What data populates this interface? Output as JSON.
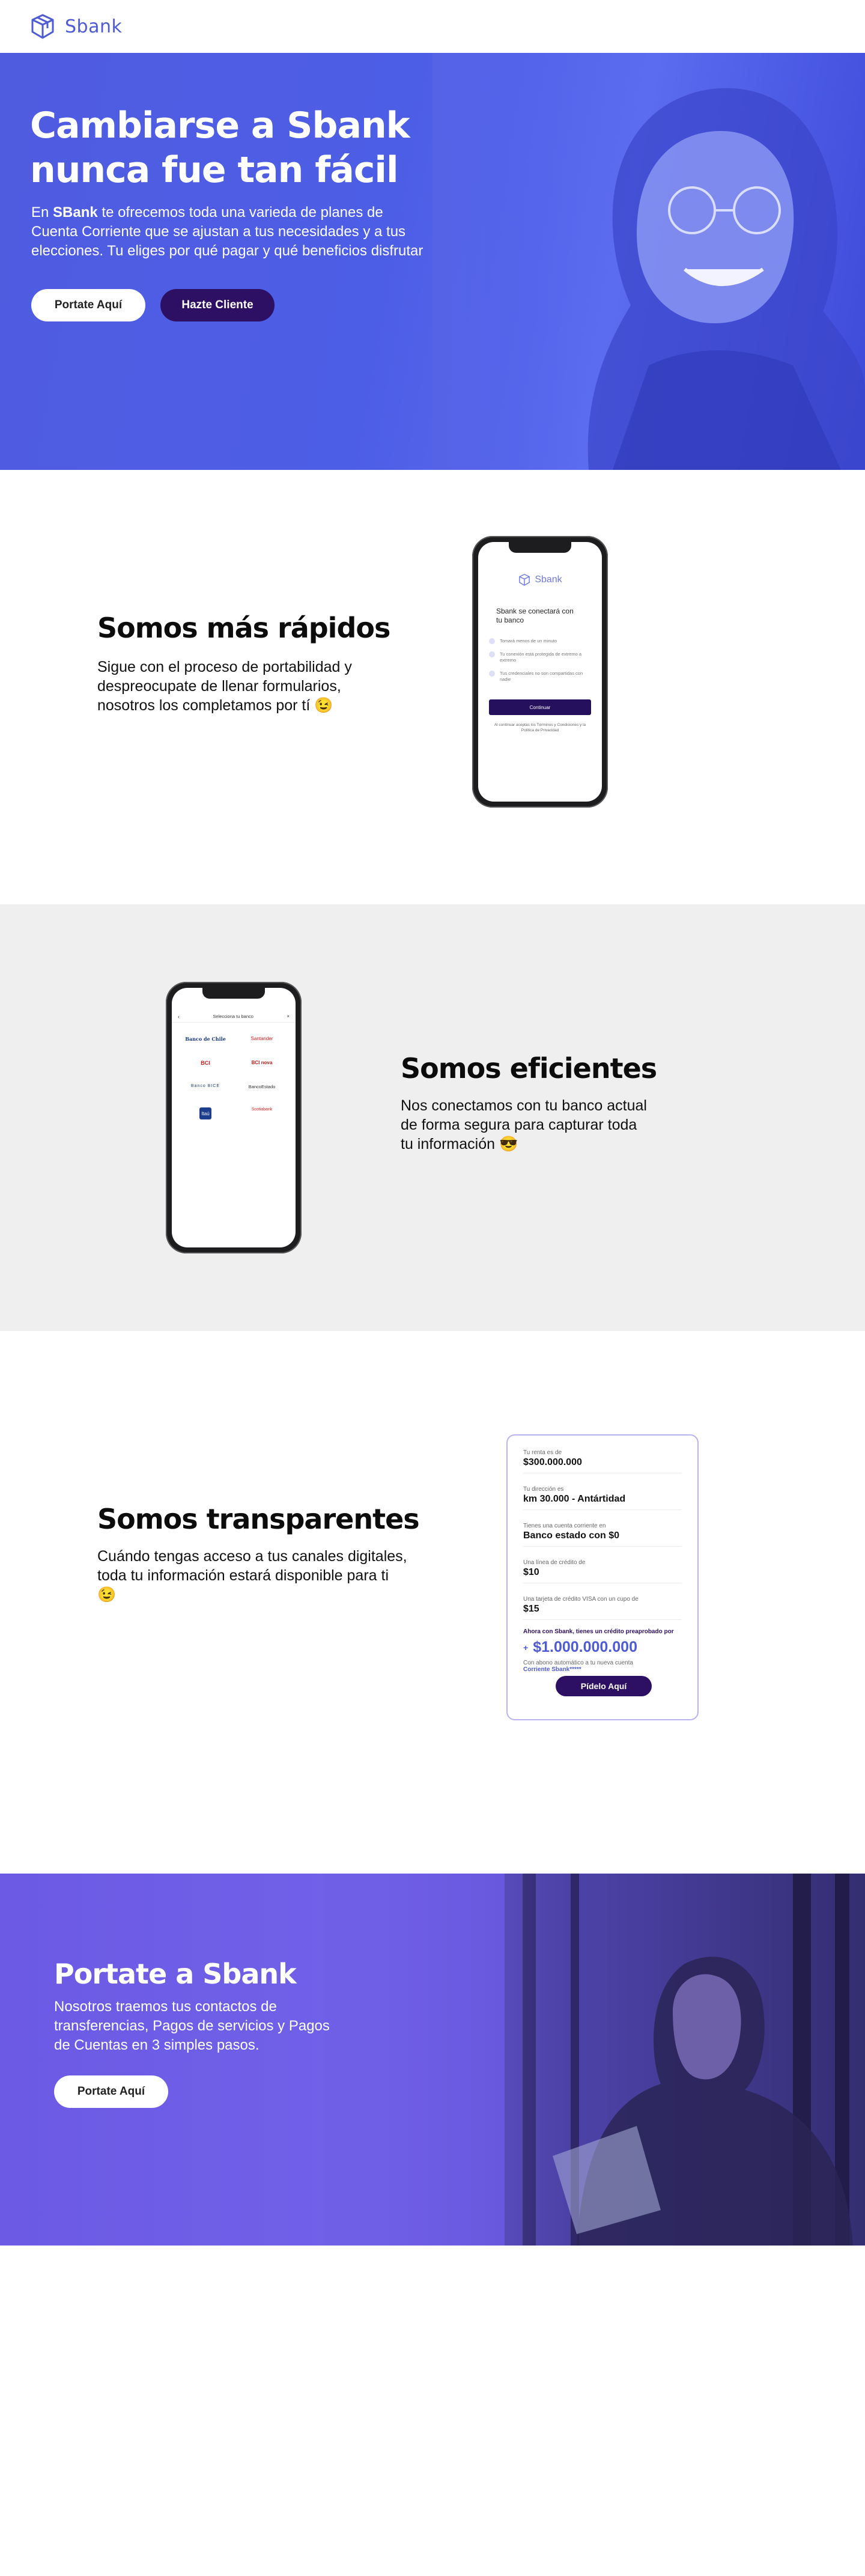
{
  "header": {
    "logo_text": "Sbank",
    "logo_icon": "cube-logo-icon"
  },
  "hero": {
    "title_line1": "Cambiarse a Sbank",
    "title_line2": "nunca fue tan fácil",
    "desc_prefix": "En ",
    "desc_brand": "SBank",
    "desc_rest": " te ofrecemos toda una varieda de planes de Cuenta Corriente que se ajustan a tus necesidades y a tus elecciones. Tu eliges por qué pagar y qué beneficios disfrutar",
    "btn_portate": "Portate Aquí",
    "btn_cliente": "Hazte Cliente"
  },
  "rapidos": {
    "title": "Somos más rápidos",
    "text": "Sigue con el proceso de portabilidad y despreocupate de llenar formularios, nosotros los completamos por tí 😉",
    "phone": {
      "logo_text": "Sbank",
      "heading": "Sbank se conectará con tu banco",
      "items": [
        "Tomará menos de un minuto",
        "Tu conexión está protegida de extremo a extremo",
        "Tus credenciales no son compartidas con nadie"
      ],
      "button": "Continuar",
      "footer": "Al continuar aceptas los Términos y Condiciones y la Política de Privacidad"
    }
  },
  "eficientes": {
    "title": "Somos eficientes",
    "text": "Nos conectamos con tu banco actual de forma segura para capturar toda tu información 😎",
    "phone": {
      "header": "Selecciona tu banco",
      "banks": [
        "Banco de Chile",
        "Santander",
        "BCI",
        "BCI nova",
        "Banco BICE",
        "BancoEstado",
        "Itaú",
        "Scotiabank"
      ]
    }
  },
  "transparentes": {
    "title": "Somos transparentes",
    "text": "Cuándo tengas acceso a tus canales digitales, toda tu información estará disponible para ti 😉",
    "card": {
      "rows": [
        {
          "label": "Tu renta es de",
          "value": "$300.000.000"
        },
        {
          "label": "Tu dirección es",
          "value": "km 30.000 - Antártidad"
        },
        {
          "label": "Tienes una cuenta corriente en",
          "value": "Banco estado con $0"
        },
        {
          "label": "Una línea de crédito de",
          "value": "$10"
        },
        {
          "label": "Una tarjeta de crédito VISA con un cupo de",
          "value": "$15"
        }
      ],
      "offer_label": "Ahora con Sbank, tienes un crédito preaprobado por",
      "offer_value": "$1.000.000.000",
      "deposit_text": "Con abono automático a tu nueva cuenta",
      "deposit_link": "Corriente Sbank*****",
      "button": "Pídelo Aquí"
    }
  },
  "banner": {
    "title": "Portate a Sbank",
    "text": "Nosotros  traemos tus contactos de transferencias, Pagos de servicios y Pagos de Cuentas en 3 simples pasos.",
    "button": "Portate Aquí"
  },
  "colors": {
    "brand_blue": "#4f5bd5",
    "dark_purple": "#2d0f63",
    "banner_purple": "#6c5ae4"
  }
}
